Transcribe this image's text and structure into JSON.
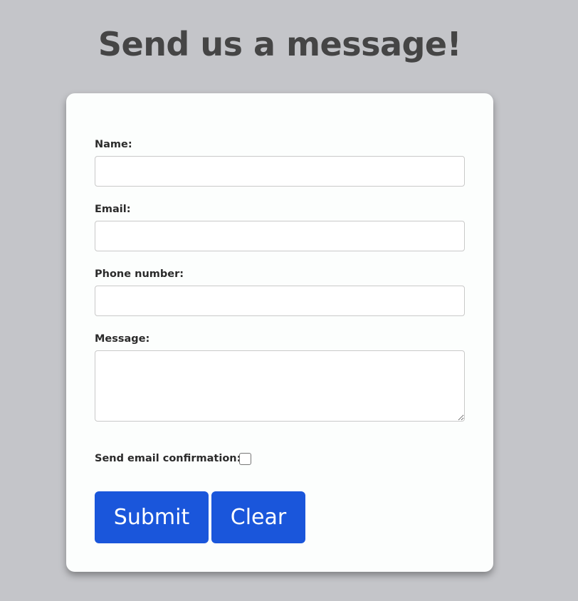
{
  "page": {
    "title": "Send us a message!"
  },
  "form": {
    "fields": [
      {
        "label": "Name:",
        "value": "",
        "placeholder": ""
      },
      {
        "label": "Email:",
        "value": "",
        "placeholder": ""
      },
      {
        "label": "Phone number:",
        "value": "",
        "placeholder": ""
      },
      {
        "label": "Message:",
        "value": "",
        "placeholder": ""
      }
    ],
    "confirmation": {
      "label": "Send email confirmation:",
      "checked": false
    },
    "buttons": {
      "submit_label": "Submit",
      "clear_label": "Clear"
    }
  },
  "colors": {
    "background": "#c4c5c9",
    "card": "#fcfefd",
    "title_text": "#454545",
    "button": "#1a56db",
    "button_text": "#ffffff"
  }
}
